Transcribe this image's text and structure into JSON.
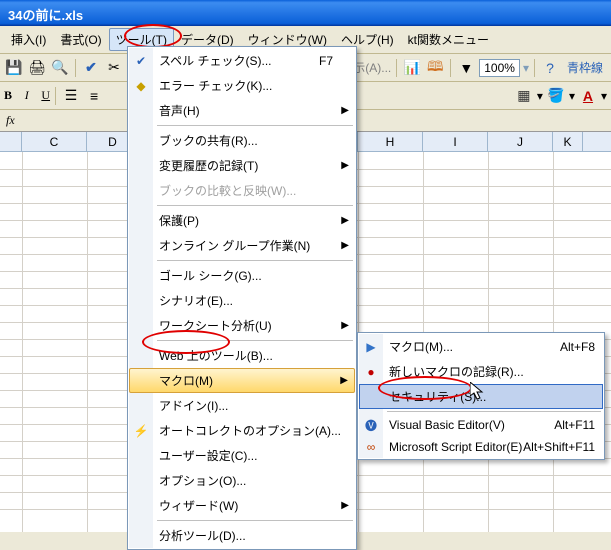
{
  "title": "34の前に.xls",
  "menubar": {
    "insert": "挿入(I)",
    "format": "書式(O)",
    "tools": "ツール(T)",
    "data": "データ(D)",
    "window": "ウィンドウ(W)",
    "help": "ヘルプ(H)",
    "kt": "kt関数メニュー"
  },
  "toolbar": {
    "zoom": "100%",
    "border_btn": "青枠線",
    "show_all": "べて表示(A)..."
  },
  "formula_label": "fx",
  "columns": [
    "C",
    "D",
    "H",
    "I",
    "J",
    "K"
  ],
  "tools_menu": {
    "spell": "スペル チェック(S)...",
    "spell_sc": "F7",
    "error": "エラー チェック(K)...",
    "speech": "音声(H)",
    "share": "ブックの共有(R)...",
    "track": "変更履歴の記録(T)",
    "compare": "ブックの比較と反映(W)...",
    "protect": "保護(P)",
    "online": "オンライン グループ作業(N)",
    "goal": "ゴール シーク(G)...",
    "scenario": "シナリオ(E)...",
    "audit": "ワークシート分析(U)",
    "web": "Web 上のツール(B)...",
    "macro": "マクロ(M)",
    "addin": "アドイン(I)...",
    "autocorrect": "オートコレクトのオプション(A)...",
    "customize": "ユーザー設定(C)...",
    "options": "オプション(O)...",
    "wizard": "ウィザード(W)",
    "analysis": "分析ツール(D)..."
  },
  "macro_menu": {
    "macros": "マクロ(M)...",
    "macros_sc": "Alt+F8",
    "record": "新しいマクロの記録(R)...",
    "security": "セキュリティ(S)...",
    "vbe": "Visual Basic Editor(V)",
    "vbe_sc": "Alt+F11",
    "mse": "Microsoft Script Editor(E)",
    "mse_sc": "Alt+Shift+F11"
  }
}
